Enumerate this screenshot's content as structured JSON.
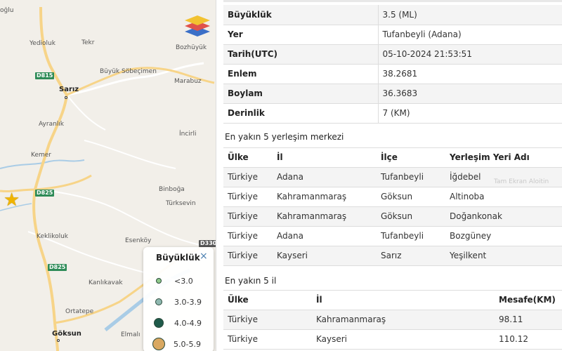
{
  "map": {
    "places": [
      {
        "id": "oglu",
        "text": "oğlu"
      },
      {
        "id": "yedioluk",
        "text": "Yedioluk"
      },
      {
        "id": "tekr",
        "text": "Tekr"
      },
      {
        "id": "bozhuyuk",
        "text": "Bozhüyük"
      },
      {
        "id": "buyuk-sobecimen",
        "text": "Büyük Söbeçimen"
      },
      {
        "id": "marabuz",
        "text": "Marabuz"
      },
      {
        "id": "sariz",
        "text": "Sarız"
      },
      {
        "id": "ayranlik",
        "text": "Ayranlık"
      },
      {
        "id": "incirli",
        "text": "İncirli"
      },
      {
        "id": "kemer",
        "text": "Kemer"
      },
      {
        "id": "binboga",
        "text": "Binboğa"
      },
      {
        "id": "turksevin",
        "text": "Türksevin"
      },
      {
        "id": "keklikoluk",
        "text": "Keklikoluk"
      },
      {
        "id": "esenkoy",
        "text": "Esenköy"
      },
      {
        "id": "kanlikavak",
        "text": "Kanlıkavak"
      },
      {
        "id": "ortatepe",
        "text": "Ortatepe"
      },
      {
        "id": "goksun",
        "text": "Göksun"
      },
      {
        "id": "elmali",
        "text": "Elmalı"
      }
    ],
    "road_labels": [
      "D815",
      "D825",
      "D825",
      "D330"
    ],
    "legend": {
      "title": "Büyüklük",
      "close": "×",
      "items": [
        {
          "label": "<3.0",
          "color": "#8fc98a"
        },
        {
          "label": "3.0-3.9",
          "color": "#8fb8b0"
        },
        {
          "label": "4.0-4.9",
          "color": "#1f5a4a"
        },
        {
          "label": "5.0-5.9",
          "color": "#d9a861"
        }
      ]
    },
    "epicenter_icon": "star-icon",
    "layers_icon": "layers-icon"
  },
  "details": [
    {
      "label": "Büyüklük",
      "value": "3.5 (ML)"
    },
    {
      "label": "Yer",
      "value": "Tufanbeyli (Adana)"
    },
    {
      "label": "Tarih(UTC)",
      "value": "05-10-2024 21:53:51"
    },
    {
      "label": "Enlem",
      "value": "38.2681"
    },
    {
      "label": "Boylam",
      "value": "36.3683"
    },
    {
      "label": "Derinlik",
      "value": "7 (KM)"
    }
  ],
  "settlements": {
    "title": "En yakın 5 yerleşim merkezi",
    "headers": [
      "Ülke",
      "İl",
      "İlçe",
      "Yerleşim Yeri Adı"
    ],
    "rows": [
      [
        "Türkiye",
        "Adana",
        "Tufanbeyli",
        "İğdebel"
      ],
      [
        "Türkiye",
        "Kahramanmaraş",
        "Göksun",
        "Altinoba"
      ],
      [
        "Türkiye",
        "Kahramanmaraş",
        "Göksun",
        "Doğankonak"
      ],
      [
        "Türkiye",
        "Adana",
        "Tufanbeyli",
        "Bozgüney"
      ],
      [
        "Türkiye",
        "Kayseri",
        "Sarız",
        "Yeşilkent"
      ]
    ]
  },
  "provinces": {
    "title": "En yakın 5 il",
    "headers": [
      "Ülke",
      "İl",
      "Mesafe(KM)"
    ],
    "rows": [
      [
        "Türkiye",
        "Kahramanmaraş",
        "98.11"
      ],
      [
        "Türkiye",
        "Kayseri",
        "110.12"
      ]
    ]
  },
  "ghost_text": "Tam Ekran Aloitin"
}
